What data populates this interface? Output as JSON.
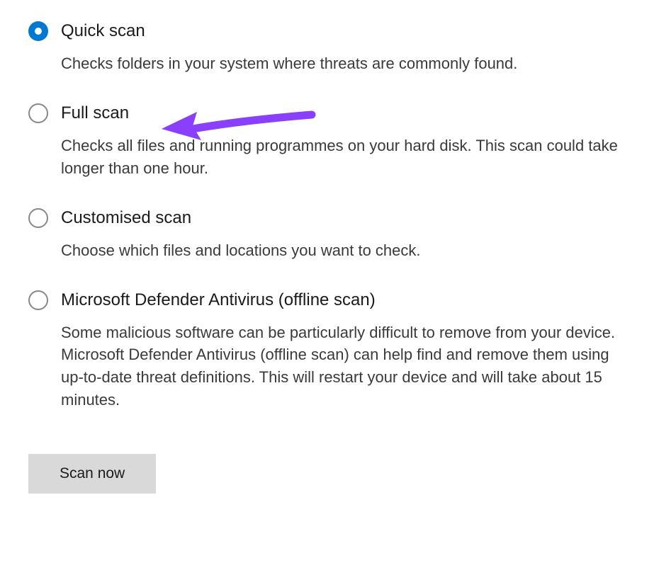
{
  "scanOptions": [
    {
      "id": "quick",
      "label": "Quick scan",
      "description": "Checks folders in your system where threats are commonly found.",
      "selected": true
    },
    {
      "id": "full",
      "label": "Full scan",
      "description": "Checks all files and running programmes on your hard disk. This scan could take longer than one hour.",
      "selected": false
    },
    {
      "id": "custom",
      "label": "Customised scan",
      "description": "Choose which files and locations you want to check.",
      "selected": false
    },
    {
      "id": "offline",
      "label": "Microsoft Defender Antivirus (offline scan)",
      "description": "Some malicious software can be particularly difficult to remove from your device. Microsoft Defender Antivirus (offline scan) can help find and remove them using up-to-date threat definitions. This will restart your device and will take about 15 minutes.",
      "selected": false
    }
  ],
  "scanButton": {
    "label": "Scan now"
  },
  "annotation": {
    "color": "#8a3ffc",
    "target": "full"
  }
}
